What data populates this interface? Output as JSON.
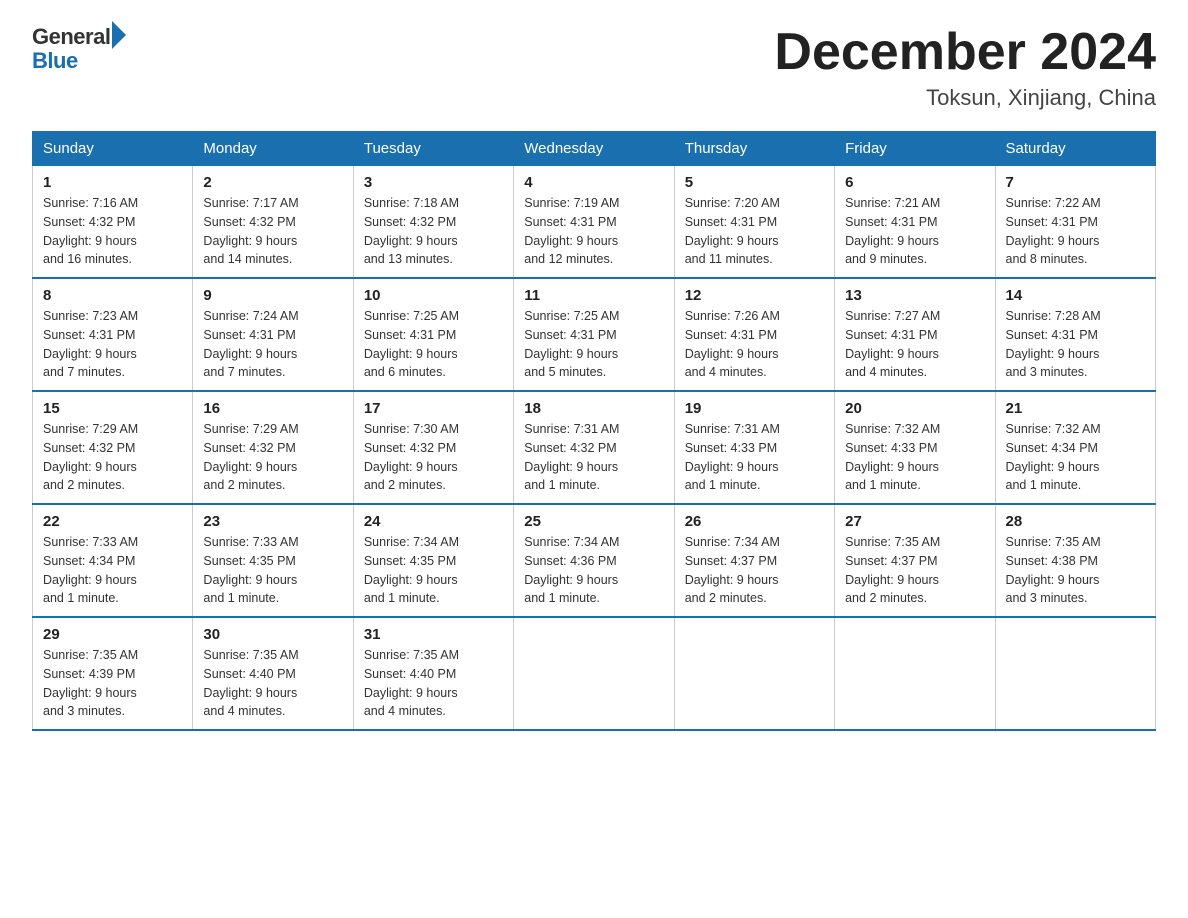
{
  "header": {
    "logo_general": "General",
    "logo_blue": "Blue",
    "month_title": "December 2024",
    "subtitle": "Toksun, Xinjiang, China"
  },
  "days_of_week": [
    "Sunday",
    "Monday",
    "Tuesday",
    "Wednesday",
    "Thursday",
    "Friday",
    "Saturday"
  ],
  "weeks": [
    [
      {
        "day": "1",
        "sunrise": "7:16 AM",
        "sunset": "4:32 PM",
        "daylight": "9 hours and 16 minutes."
      },
      {
        "day": "2",
        "sunrise": "7:17 AM",
        "sunset": "4:32 PM",
        "daylight": "9 hours and 14 minutes."
      },
      {
        "day": "3",
        "sunrise": "7:18 AM",
        "sunset": "4:32 PM",
        "daylight": "9 hours and 13 minutes."
      },
      {
        "day": "4",
        "sunrise": "7:19 AM",
        "sunset": "4:31 PM",
        "daylight": "9 hours and 12 minutes."
      },
      {
        "day": "5",
        "sunrise": "7:20 AM",
        "sunset": "4:31 PM",
        "daylight": "9 hours and 11 minutes."
      },
      {
        "day": "6",
        "sunrise": "7:21 AM",
        "sunset": "4:31 PM",
        "daylight": "9 hours and 9 minutes."
      },
      {
        "day": "7",
        "sunrise": "7:22 AM",
        "sunset": "4:31 PM",
        "daylight": "9 hours and 8 minutes."
      }
    ],
    [
      {
        "day": "8",
        "sunrise": "7:23 AM",
        "sunset": "4:31 PM",
        "daylight": "9 hours and 7 minutes."
      },
      {
        "day": "9",
        "sunrise": "7:24 AM",
        "sunset": "4:31 PM",
        "daylight": "9 hours and 7 minutes."
      },
      {
        "day": "10",
        "sunrise": "7:25 AM",
        "sunset": "4:31 PM",
        "daylight": "9 hours and 6 minutes."
      },
      {
        "day": "11",
        "sunrise": "7:25 AM",
        "sunset": "4:31 PM",
        "daylight": "9 hours and 5 minutes."
      },
      {
        "day": "12",
        "sunrise": "7:26 AM",
        "sunset": "4:31 PM",
        "daylight": "9 hours and 4 minutes."
      },
      {
        "day": "13",
        "sunrise": "7:27 AM",
        "sunset": "4:31 PM",
        "daylight": "9 hours and 4 minutes."
      },
      {
        "day": "14",
        "sunrise": "7:28 AM",
        "sunset": "4:31 PM",
        "daylight": "9 hours and 3 minutes."
      }
    ],
    [
      {
        "day": "15",
        "sunrise": "7:29 AM",
        "sunset": "4:32 PM",
        "daylight": "9 hours and 2 minutes."
      },
      {
        "day": "16",
        "sunrise": "7:29 AM",
        "sunset": "4:32 PM",
        "daylight": "9 hours and 2 minutes."
      },
      {
        "day": "17",
        "sunrise": "7:30 AM",
        "sunset": "4:32 PM",
        "daylight": "9 hours and 2 minutes."
      },
      {
        "day": "18",
        "sunrise": "7:31 AM",
        "sunset": "4:32 PM",
        "daylight": "9 hours and 1 minute."
      },
      {
        "day": "19",
        "sunrise": "7:31 AM",
        "sunset": "4:33 PM",
        "daylight": "9 hours and 1 minute."
      },
      {
        "day": "20",
        "sunrise": "7:32 AM",
        "sunset": "4:33 PM",
        "daylight": "9 hours and 1 minute."
      },
      {
        "day": "21",
        "sunrise": "7:32 AM",
        "sunset": "4:34 PM",
        "daylight": "9 hours and 1 minute."
      }
    ],
    [
      {
        "day": "22",
        "sunrise": "7:33 AM",
        "sunset": "4:34 PM",
        "daylight": "9 hours and 1 minute."
      },
      {
        "day": "23",
        "sunrise": "7:33 AM",
        "sunset": "4:35 PM",
        "daylight": "9 hours and 1 minute."
      },
      {
        "day": "24",
        "sunrise": "7:34 AM",
        "sunset": "4:35 PM",
        "daylight": "9 hours and 1 minute."
      },
      {
        "day": "25",
        "sunrise": "7:34 AM",
        "sunset": "4:36 PM",
        "daylight": "9 hours and 1 minute."
      },
      {
        "day": "26",
        "sunrise": "7:34 AM",
        "sunset": "4:37 PM",
        "daylight": "9 hours and 2 minutes."
      },
      {
        "day": "27",
        "sunrise": "7:35 AM",
        "sunset": "4:37 PM",
        "daylight": "9 hours and 2 minutes."
      },
      {
        "day": "28",
        "sunrise": "7:35 AM",
        "sunset": "4:38 PM",
        "daylight": "9 hours and 3 minutes."
      }
    ],
    [
      {
        "day": "29",
        "sunrise": "7:35 AM",
        "sunset": "4:39 PM",
        "daylight": "9 hours and 3 minutes."
      },
      {
        "day": "30",
        "sunrise": "7:35 AM",
        "sunset": "4:40 PM",
        "daylight": "9 hours and 4 minutes."
      },
      {
        "day": "31",
        "sunrise": "7:35 AM",
        "sunset": "4:40 PM",
        "daylight": "9 hours and 4 minutes."
      },
      null,
      null,
      null,
      null
    ]
  ],
  "labels": {
    "sunrise": "Sunrise:",
    "sunset": "Sunset:",
    "daylight": "Daylight:"
  }
}
